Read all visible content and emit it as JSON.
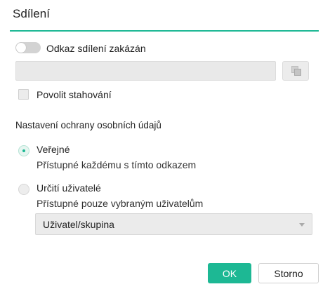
{
  "dialog": {
    "title": "Sdílení"
  },
  "sharing_link": {
    "toggle_label": "Odkaz sdílení zakázán",
    "toggle_on": false,
    "link_value": "",
    "copy_icon": "copy-icon"
  },
  "download": {
    "checkbox_label": "Povolit stahování",
    "checked": false
  },
  "privacy": {
    "heading": "Nastavení ochrany osobních údajů",
    "options": [
      {
        "title": "Veřejné",
        "description": "Přístupné každému s tímto odkazem",
        "selected": true
      },
      {
        "title": "Určití uživatelé",
        "description": "Přístupné pouze vybraným uživatelům",
        "selected": false
      }
    ],
    "user_select_value": "Uživatel/skupina"
  },
  "buttons": {
    "ok": "OK",
    "cancel": "Storno"
  },
  "colors": {
    "accent": "#1db894"
  }
}
